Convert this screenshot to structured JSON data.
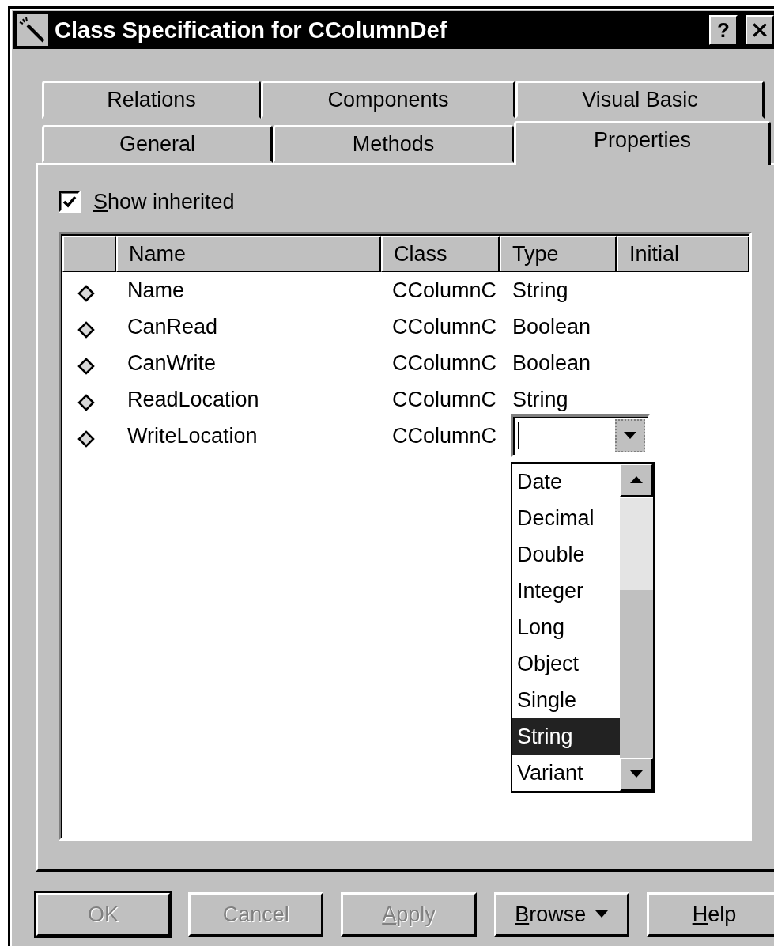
{
  "window": {
    "title": "Class Specification for CColumnDef",
    "help_button": "?"
  },
  "tabs": [
    [
      {
        "label": "Relations",
        "selected": false
      },
      {
        "label": "Components",
        "selected": false
      },
      {
        "label": "Visual Basic",
        "selected": false
      }
    ],
    [
      {
        "label": "General",
        "selected": false
      },
      {
        "label": "Methods",
        "selected": false
      },
      {
        "label": "Properties",
        "selected": true
      }
    ]
  ],
  "show_inherited": {
    "label": "Show inherited",
    "checked": true,
    "first_letter_underlined": true
  },
  "table": {
    "columns": [
      "Name",
      "Class",
      "Type",
      "Initial"
    ],
    "rows": [
      {
        "kind": "text",
        "name": "Name",
        "class": "CColumnC",
        "type": "String"
      },
      {
        "kind": "text",
        "name": "CanRead",
        "class": "CColumnC",
        "type": "Boolean"
      },
      {
        "kind": "text",
        "name": "CanWrite",
        "class": "CColumnC",
        "type": "Boolean"
      },
      {
        "kind": "text",
        "name": "ReadLocation",
        "class": "CColumnC",
        "type": "String"
      },
      {
        "kind": "combo",
        "name": "WriteLocation",
        "class": "CColumnC",
        "expanded": true,
        "options": [
          {
            "label": "Date",
            "selected": false
          },
          {
            "label": "Decimal",
            "selected": false
          },
          {
            "label": "Double",
            "selected": false
          },
          {
            "label": "Integer",
            "selected": false
          },
          {
            "label": "Long",
            "selected": false
          },
          {
            "label": "Object",
            "selected": false
          },
          {
            "label": "Single",
            "selected": false
          },
          {
            "label": "String",
            "selected": true
          },
          {
            "label": "Variant",
            "selected": false
          }
        ]
      }
    ]
  },
  "buttons": [
    {
      "label": "OK",
      "kind": "push",
      "disabled": true,
      "default": true,
      "first_letter_underlined": false
    },
    {
      "label": "Cancel",
      "kind": "push",
      "disabled": true,
      "default": false,
      "first_letter_underlined": false
    },
    {
      "label": "Apply",
      "kind": "push",
      "disabled": true,
      "default": false,
      "first_letter_underlined": true
    },
    {
      "label": "Browse",
      "kind": "menu",
      "disabled": false,
      "default": false,
      "first_letter_underlined": true
    },
    {
      "label": "Help",
      "kind": "push",
      "disabled": false,
      "default": false,
      "first_letter_underlined": true
    }
  ]
}
